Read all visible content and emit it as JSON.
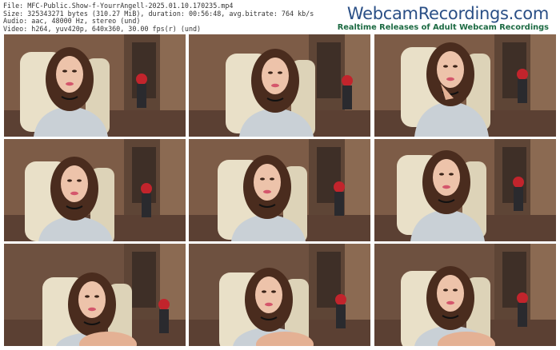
{
  "info": {
    "file": "File: MFC-Public.Show-f-YourrAngell-2025.01.10.170235.mp4",
    "size": "Size: 325343271 bytes (310.27 MiB), duration: 00:56:48, avg.bitrate: 764 kb/s",
    "audio": "Audio: aac, 48000 Hz, stereo (und)",
    "video": "Video: h264, yuv420p, 640x360, 30.00 fps(r) (und)"
  },
  "brand": {
    "title": "WebcamRecordings.com",
    "subtitle": "Realtime Releases of Adult Webcam Recordings"
  },
  "thumbnails": [
    {
      "id": 1
    },
    {
      "id": 2
    },
    {
      "id": 3
    },
    {
      "id": 4
    },
    {
      "id": 5
    },
    {
      "id": 6
    },
    {
      "id": 7
    },
    {
      "id": 8
    },
    {
      "id": 9
    }
  ],
  "colors": {
    "brand_blue": "#2a4f86",
    "brand_green": "#1c6a42"
  }
}
